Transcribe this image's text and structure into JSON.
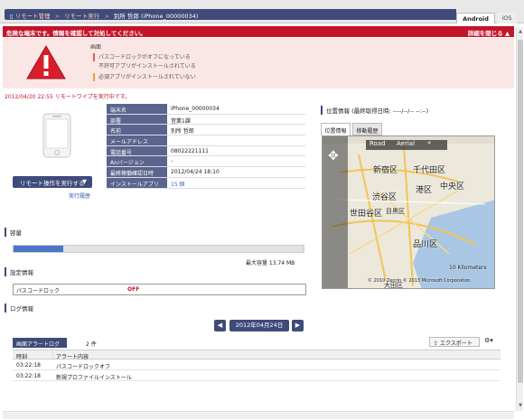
{
  "breadcrumb": {
    "root": "リモート管理",
    "middle": "リモート実行",
    "current": "別所 哲郎 (iPhone_00000034)"
  },
  "os_tabs": {
    "android": "Android",
    "ios": "iOS"
  },
  "alert": {
    "banner": "危険な端末です。情報を確認して対処してください。",
    "details_link": "詳細を閉じる ▲",
    "title": "画面",
    "items": [
      "パスコードロックがオフになっている",
      "不許可アプリがインストールされている",
      "必須アプリがインストールされていない"
    ]
  },
  "wipe_message": "2012/04/20 22:55 リモートワイプを実行中です。",
  "remote_button": "リモート操作を実行する",
  "history_link": "実行履歴",
  "device_info": [
    {
      "label": "端末名",
      "value": "iPhone_00000034"
    },
    {
      "label": "部署",
      "value": "営業1課"
    },
    {
      "label": "名前",
      "value": "別所 哲郎"
    },
    {
      "label": "メールアドレス",
      "value": ""
    },
    {
      "label": "電話番号",
      "value": "08022221111"
    },
    {
      "label": "Anバージョン",
      "value": "-"
    },
    {
      "label": "最終稼働確認日時",
      "value": "2012/04/24 18:10"
    },
    {
      "label": "インストールアプリ",
      "value": "15 個"
    }
  ],
  "location": {
    "title": "位置情報 (最終取得日時: ----/--/-- --:--)",
    "tabs": [
      "位置情報",
      "移動履歴"
    ],
    "map_mode_road": "Road",
    "map_mode_aerial": "Aerial",
    "map_labels": [
      "新宿区",
      "千代田区",
      "中央区",
      "渋谷区",
      "港区",
      "目黒区",
      "品川区",
      "大田区",
      "世田谷区"
    ],
    "scale": "10 Kilometers",
    "copyright": "© 2010 Zenrin © 2013 Microsoft Corporation"
  },
  "capacity": {
    "section": "容量",
    "max_label": "最大容量 13.74 MB",
    "used_fraction": 0.17
  },
  "settings": {
    "section": "設定情報",
    "passcode_label": "パスコードロック",
    "passcode_value": "OFF"
  },
  "log": {
    "section": "ログ情報",
    "date": "2012年04月24日",
    "tab": "画面アラートログ",
    "count": "2 件",
    "export": "エクスポート",
    "columns": [
      "時刻",
      "アラート内容"
    ],
    "rows": [
      {
        "time": "03:22:18",
        "content": "パスコードロックオフ"
      },
      {
        "time": "03:22:18",
        "content": "新規プロファイルインストール"
      }
    ]
  },
  "colors": {
    "navy": "#3f4b7a",
    "alert_red": "#c4142a",
    "label_blue": "#5a648c",
    "link": "#3a5fb0"
  }
}
